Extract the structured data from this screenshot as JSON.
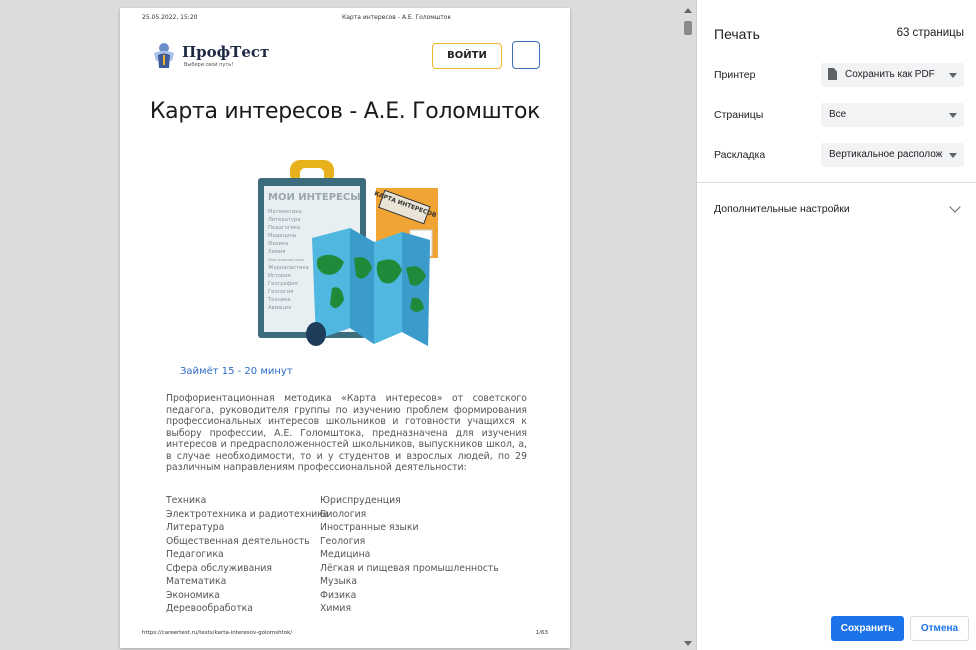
{
  "preview": {
    "header_date": "25.05.2022, 15:20",
    "header_title": "Карта интересов - А.Е. Голомшток",
    "logo_name": "ПрофТест",
    "logo_tagline": "Выбери свой путь!",
    "login_button": "ВОЙТИ",
    "page_title": "Карта интересов - А.Е. Голомшток",
    "illustration": {
      "folder_title": "МОИ ИНТЕРЕСЫ",
      "folder_items": [
        "Математика",
        "Литература",
        "Педагогика",
        "Медицина",
        "Физика",
        "Химия",
        "Иностранный язык",
        "Журналистика",
        "История",
        "География",
        "Геология",
        "Техника",
        "Авиация"
      ],
      "book_label": "КАРТА ИНТЕРЕСОВ"
    },
    "duration": "Займёт 15 - 20 минут",
    "description": "Профориентационная методика «Карта интересов» от советского педагога, руководителя группы по изучению проблем формирования профессиональных интересов школьников и готовности учащихся к выбору профессии, А.Е. Голомштока, предназначена для изучения интересов и предрасположенностей школьников, выпускников школ, а, в случае необходимости, то и у студентов и взрослых людей, по 29 различным направлениям профессиональной деятельности:",
    "topics_col1": [
      "Техника",
      "Электротехника и радиотехника",
      "Литература",
      "Общественная деятельность",
      "Педагогика",
      "Сфера обслуживания",
      "Математика",
      "Экономика",
      "Деревообработка"
    ],
    "topics_col2": [
      "Юриспруденция",
      "Биология",
      "Иностранные языки",
      "Геология",
      "Медицина",
      "Лёгкая и пищевая промышленность",
      "Музыка",
      "Физика",
      "Химия"
    ],
    "footer_url": "https://careertest.ru/tests/karta-interesov-golomshtok/",
    "footer_page": "1/63"
  },
  "settings": {
    "title": "Печать",
    "page_count": "63 страницы",
    "printer_label": "Принтер",
    "printer_value": "Сохранить как PDF",
    "pages_label": "Страницы",
    "pages_value": "Все",
    "layout_label": "Раскладка",
    "layout_value": "Вертикальное расположение",
    "more_settings": "Дополнительные настройки",
    "save_button": "Сохранить",
    "cancel_button": "Отмена"
  },
  "colors": {
    "accent": "#1a73e8",
    "link_blue": "#2d6bc4",
    "login_border": "#f0b429",
    "preview_bg": "#dcdcdc"
  }
}
